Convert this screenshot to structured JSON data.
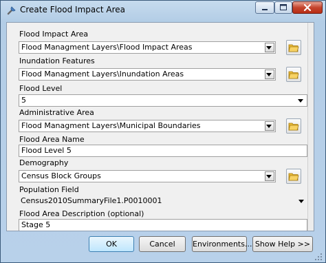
{
  "window": {
    "title": "Create Flood Impact Area"
  },
  "fields": {
    "flood_impact_area": {
      "label": "Flood Impact Area",
      "value": "Flood Managment Layers\\Flood Impact Areas"
    },
    "inundation_features": {
      "label": "Inundation Features",
      "value": "Flood Managment Layers\\Inundation Areas"
    },
    "flood_level": {
      "label": "Flood Level",
      "value": "5"
    },
    "administrative_area": {
      "label": "Administrative Area",
      "value": "Flood Managment Layers\\Municipal Boundaries"
    },
    "flood_area_name": {
      "label": "Flood Area Name",
      "value": "Flood Level 5"
    },
    "demography": {
      "label": "Demography",
      "value": "Census Block Groups"
    },
    "population_field": {
      "label": "Population Field",
      "value": "Census2010SummaryFile1.P0010001"
    },
    "flood_area_description": {
      "label": "Flood Area Description (optional)",
      "value": "Stage 5"
    }
  },
  "buttons": {
    "ok": "OK",
    "cancel": "Cancel",
    "environments": "Environments...",
    "show_help": "Show Help >>"
  },
  "icons": {
    "app": "tool-icon",
    "browse": "open-folder-icon"
  },
  "colors": {
    "title_bar": "#b3cde6",
    "close_button": "#c4442d",
    "primary_button": "#bee6fd",
    "panel": "#f0f0f0"
  }
}
